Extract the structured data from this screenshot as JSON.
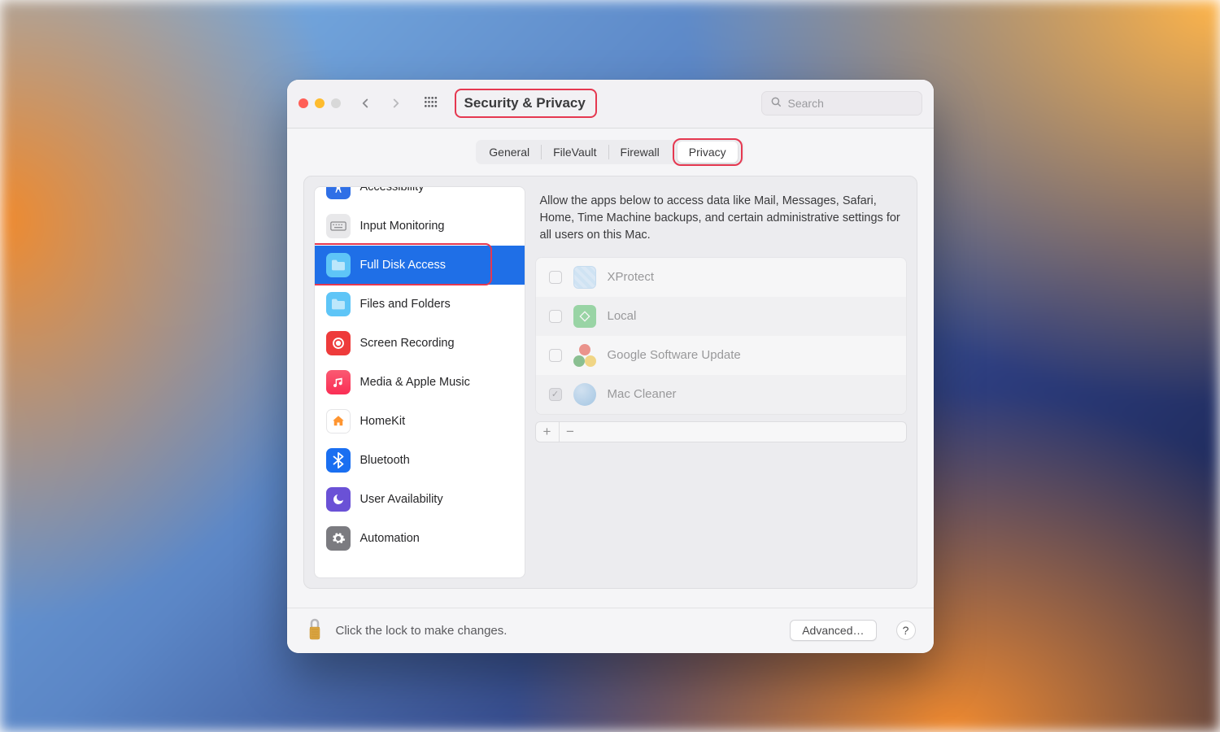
{
  "window": {
    "title": "Security & Privacy"
  },
  "search": {
    "placeholder": "Search"
  },
  "tabs": [
    {
      "label": "General"
    },
    {
      "label": "FileVault"
    },
    {
      "label": "Firewall"
    },
    {
      "label": "Privacy",
      "active": true
    }
  ],
  "sidebar": {
    "items": [
      {
        "label": "Accessibility"
      },
      {
        "label": "Input Monitoring"
      },
      {
        "label": "Full Disk Access",
        "selected": true
      },
      {
        "label": "Files and Folders"
      },
      {
        "label": "Screen Recording"
      },
      {
        "label": "Media & Apple Music"
      },
      {
        "label": "HomeKit"
      },
      {
        "label": "Bluetooth"
      },
      {
        "label": "User Availability"
      },
      {
        "label": "Automation"
      }
    ]
  },
  "detail": {
    "description": "Allow the apps below to access data like Mail, Messages, Safari, Home, Time Machine backups, and certain administrative settings for all users on this Mac."
  },
  "apps": [
    {
      "name": "XProtect",
      "checked": false
    },
    {
      "name": "Local",
      "checked": false
    },
    {
      "name": "Google Software Update",
      "checked": false
    },
    {
      "name": "Mac Cleaner",
      "checked": true
    }
  ],
  "footer": {
    "lock_text": "Click the lock to make changes.",
    "advanced": "Advanced…",
    "help": "?"
  },
  "icons": {
    "plus": "+",
    "minus": "−"
  }
}
